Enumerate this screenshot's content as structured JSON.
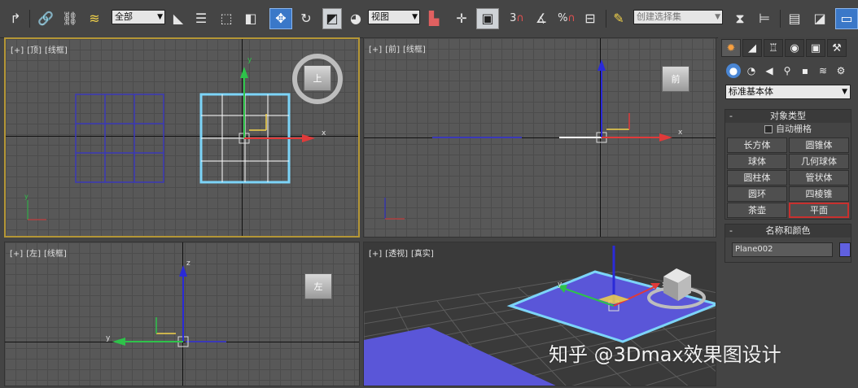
{
  "toolbar": {
    "selection_filter": "全部",
    "ref_coord": "视图",
    "named_selection_placeholder": "创建选择集",
    "snap_labels": [
      "3",
      "%"
    ]
  },
  "viewports": {
    "top": {
      "plus": "[+]",
      "name": "[顶]",
      "mode": "[线框]",
      "cube_label": "上"
    },
    "front": {
      "plus": "[+]",
      "name": "[前]",
      "mode": "[线框]",
      "cube_label": "前"
    },
    "left": {
      "plus": "[+]",
      "name": "[左]",
      "mode": "[线框]",
      "cube_label": "左"
    },
    "perspective": {
      "plus": "[+]",
      "name": "[透视]",
      "mode": "[真实]"
    },
    "axis_labels": {
      "x": "x",
      "y": "y",
      "z": "z"
    }
  },
  "command_panel": {
    "category": "标准基本体",
    "object_type": {
      "title": "对象类型",
      "autogrid_label": "自动栅格",
      "buttons": [
        "长方体",
        "圆锥体",
        "球体",
        "几何球体",
        "圆柱体",
        "管状体",
        "圆环",
        "四棱锥",
        "茶壶",
        "平面"
      ],
      "selected": "平面"
    },
    "name_color": {
      "title": "名称和颜色",
      "name": "Plane002",
      "color": "#6060e0"
    }
  },
  "colors": {
    "accent": "#3a78c8",
    "active_viewport_border": "#b49636",
    "selection": "#7cd4f8",
    "plane_fill": "#5a56d8",
    "highlight_border": "#c8302e"
  },
  "watermark": "知乎 @3Dmax效果图设计"
}
